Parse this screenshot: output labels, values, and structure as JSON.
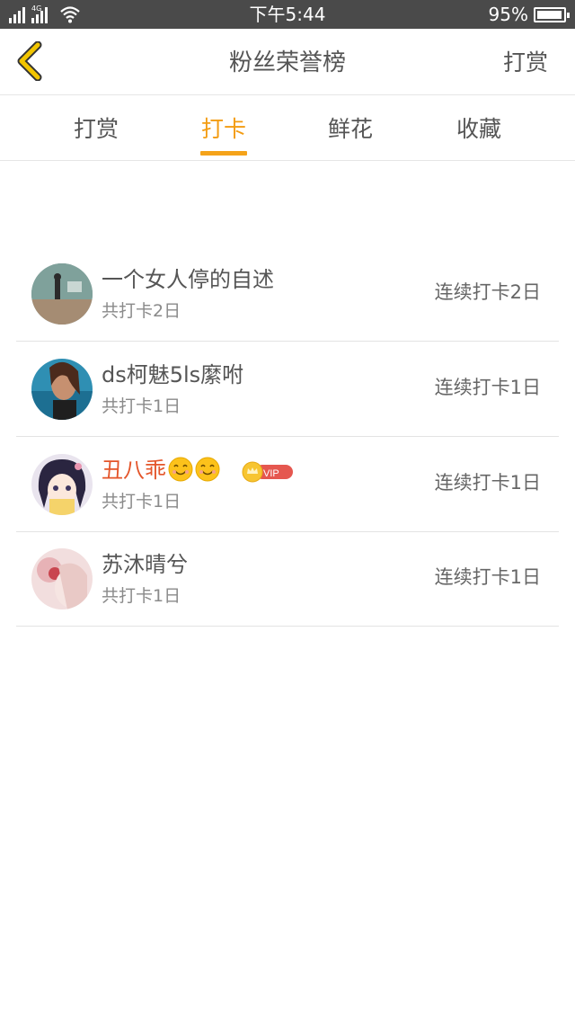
{
  "status_bar": {
    "carrier_tag": "4G",
    "time": "下午5:44",
    "battery": "95%"
  },
  "nav": {
    "title": "粉丝荣誉榜",
    "action": "打赏"
  },
  "tabs": [
    {
      "label": "打赏",
      "active": false
    },
    {
      "label": "打卡",
      "active": true
    },
    {
      "label": "鲜花",
      "active": false
    },
    {
      "label": "收藏",
      "active": false
    }
  ],
  "list": [
    {
      "name": "一个女人停的自述",
      "sub": "共打卡2日",
      "streak": "连续打卡2日"
    },
    {
      "name": "ds柯魅5ls縻咐",
      "sub": "共打卡1日",
      "streak": "连续打卡1日"
    },
    {
      "name": "丑八乖",
      "sub": "共打卡1日",
      "streak": "连续打卡1日",
      "emojis": [
        "smile-emoji",
        "smile-emoji"
      ],
      "badge": "VIP"
    },
    {
      "name": "苏沐晴兮",
      "sub": "共打卡1日",
      "streak": "连续打卡1日"
    }
  ],
  "colors": {
    "accent": "#f39c12",
    "vip_name": "#e4552a",
    "status_bar": "#4a4a4a",
    "back_icon": "#f2c500"
  }
}
